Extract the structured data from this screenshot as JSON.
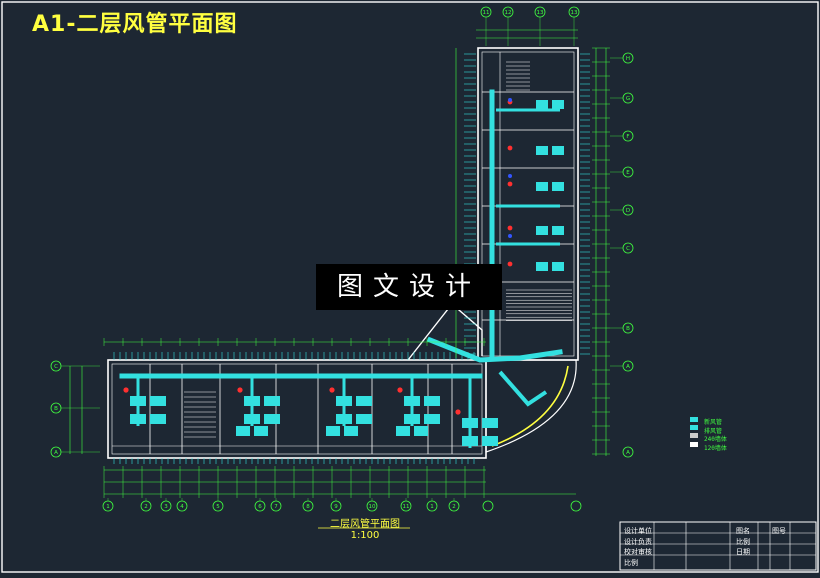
{
  "title": "A1-二层风管平面图",
  "watermark": "图文设计",
  "drawing_caption": "二层风管平面图1:100",
  "grid_labels_top": [
    "11",
    "12",
    "13",
    "13"
  ],
  "grid_labels_right": [
    "H",
    "G",
    "F",
    "E",
    "D",
    "C",
    "B",
    "A"
  ],
  "grid_labels_left": [
    "C",
    "B",
    "A"
  ],
  "grid_labels_bottom": [
    "1",
    "2",
    "3",
    "4",
    "5",
    "6",
    "7",
    "8",
    "9",
    "10",
    "11"
  ],
  "legend": [
    "新风管",
    "排风管",
    "240墙体",
    "120墙体"
  ],
  "title_block": {
    "rows": [
      [
        "设计单位",
        "",
        "图名",
        "",
        "图号",
        ""
      ],
      [
        "设计负责",
        "",
        "比例",
        "",
        "",
        ""
      ],
      [
        "校对审核",
        "",
        "日期",
        "",
        "",
        ""
      ],
      [
        "比例",
        "",
        "",
        "",
        "",
        ""
      ]
    ]
  },
  "colors": {
    "background": "#1d2733",
    "duct": "#33e0e0",
    "wall": "#ffffff",
    "dimension": "#40ff40",
    "grid_bubble": "#40ff40",
    "title": "#ffff40",
    "equipment": "#ff3030",
    "blue": "#3355ff"
  }
}
